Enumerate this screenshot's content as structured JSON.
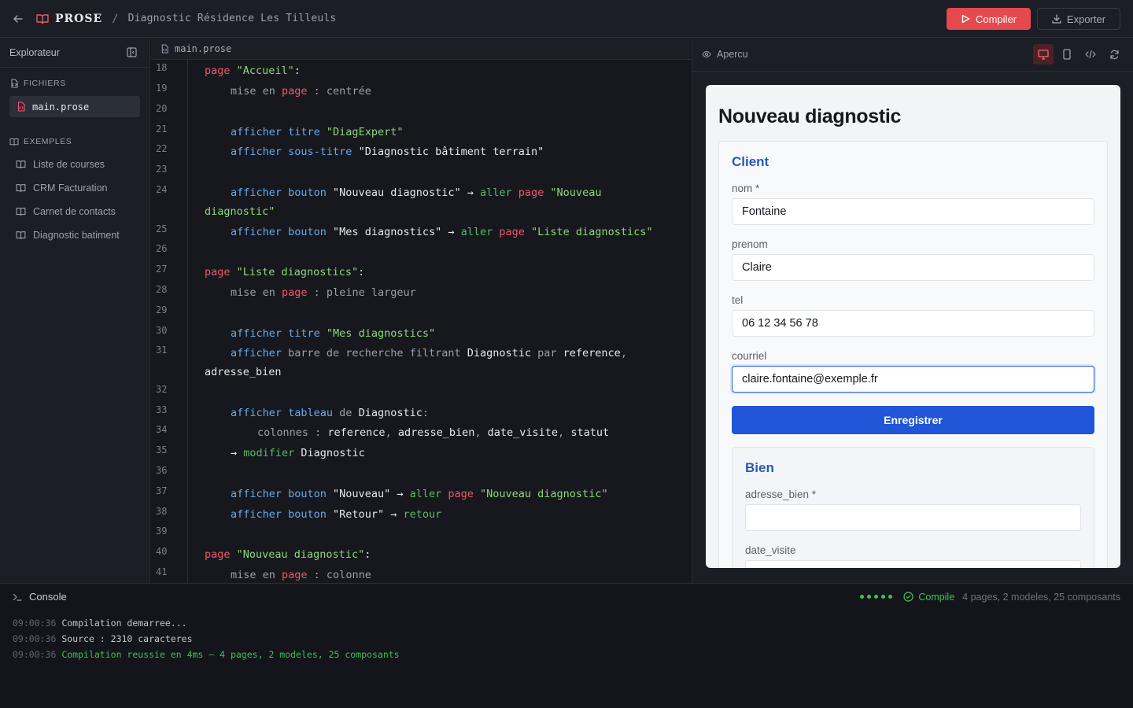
{
  "topbar": {
    "brand": "PROSE",
    "separator": "/",
    "project_title": "Diagnostic Résidence Les Tilleuls",
    "compile_label": "Compiler",
    "export_label": "Exporter"
  },
  "sidebar": {
    "title": "Explorateur",
    "files_section": "FICHIERS",
    "active_file": "main.prose",
    "examples_section": "EXEMPLES",
    "examples": [
      "Liste de courses",
      "CRM Facturation",
      "Carnet de contacts",
      "Diagnostic batiment"
    ]
  },
  "editor": {
    "tab": "main.prose",
    "line_numbers": [
      "18",
      "19",
      "20",
      "21",
      "22",
      "23",
      "24",
      "25",
      "26",
      "27",
      "28",
      "29",
      "30",
      "31",
      "32",
      "33",
      "34",
      "35",
      "36",
      "37",
      "38",
      "39",
      "40",
      "41"
    ]
  },
  "code": {
    "l18": [
      "page",
      " \"Accueil\"",
      ":"
    ],
    "l19": [
      "mise en ",
      "page",
      " : centrée"
    ],
    "l21": [
      "afficher titre",
      " \"DiagExpert\""
    ],
    "l22": [
      "afficher sous-titre",
      " \"Diagnostic bâtiment terrain\""
    ],
    "l24": [
      "afficher bouton",
      " \"Nouveau diagnostic\" → ",
      "aller",
      " ",
      "page",
      " \"Nouveau"
    ],
    "l24b": "diagnostic\"",
    "l25": [
      "afficher bouton",
      " \"Mes diagnostics\" → ",
      "aller",
      " ",
      "page",
      " \"Liste diagnostics\""
    ],
    "l27": [
      "page",
      " \"Liste diagnostics\"",
      ":"
    ],
    "l28": [
      "mise en ",
      "page",
      " : pleine largeur"
    ],
    "l30": [
      "afficher titre",
      " \"Mes diagnostics\""
    ],
    "l31": [
      "afficher",
      " barre de recherche filtrant ",
      "Diagnostic",
      " par ",
      "reference",
      ","
    ],
    "l31b": "adresse_bien",
    "l33": [
      "afficher tableau",
      " de ",
      "Diagnostic",
      ":"
    ],
    "l34": [
      "colonnes : ",
      "reference",
      ", ",
      "adresse_bien",
      ", ",
      "date_visite",
      ", ",
      "statut"
    ],
    "l35": [
      "→ ",
      "modifier",
      " Diagnostic"
    ],
    "l37": [
      "afficher bouton",
      " \"Nouveau\" → ",
      "aller",
      " ",
      "page",
      " \"Nouveau diagnostic\""
    ],
    "l38": [
      "afficher bouton",
      " \"Retour\" → ",
      "retour"
    ],
    "l40": [
      "page",
      " \"Nouveau diagnostic\"",
      ":"
    ],
    "l41": [
      "mise en ",
      "page",
      " : colonne"
    ]
  },
  "preview": {
    "header": "Apercu",
    "page_title": "Nouveau diagnostic",
    "client": {
      "section_title": "Client",
      "fields": [
        {
          "label": "nom *",
          "value": "Fontaine"
        },
        {
          "label": "prenom",
          "value": "Claire"
        },
        {
          "label": "tel",
          "value": "06 12 34 56 78"
        },
        {
          "label": "courriel",
          "value": "claire.fontaine@exemple.fr"
        }
      ],
      "save_label": "Enregistrer"
    },
    "bien": {
      "section_title": "Bien",
      "fields": [
        {
          "label": "adresse_bien *",
          "value": ""
        },
        {
          "label": "date_visite",
          "value": ""
        }
      ]
    }
  },
  "console": {
    "title": "Console",
    "status": "Compile",
    "summary": "4 pages, 2 modeles, 25 composants",
    "logs": [
      {
        "time": "09:00:36",
        "message": "Compilation demarree..."
      },
      {
        "time": "09:00:36",
        "message": "Source : 2310 caracteres"
      },
      {
        "time": "09:00:36",
        "message": "Compilation reussie en 4ms — 4 pages, 2 modeles, 25 composants"
      }
    ]
  },
  "colors": {
    "accent_red": "#e5484d",
    "primary_blue": "#1f55d6",
    "success_green": "#3fbf5a",
    "keyword_page": "#f0556d",
    "string": "#8fd67a",
    "function": "#6aa8ee"
  },
  "icons": {
    "back": "arrow-left-icon",
    "brand": "book-open-icon",
    "compile": "play-icon",
    "export": "download-icon",
    "collapse": "sidebar-collapse-icon",
    "file": "file-code-icon",
    "example": "book-icon",
    "preview": "eye-icon",
    "desktop": "monitor-icon",
    "mobile": "smartphone-icon",
    "code": "code-icon",
    "refresh": "refresh-icon",
    "terminal": "terminal-icon",
    "check": "check-circle-icon"
  }
}
